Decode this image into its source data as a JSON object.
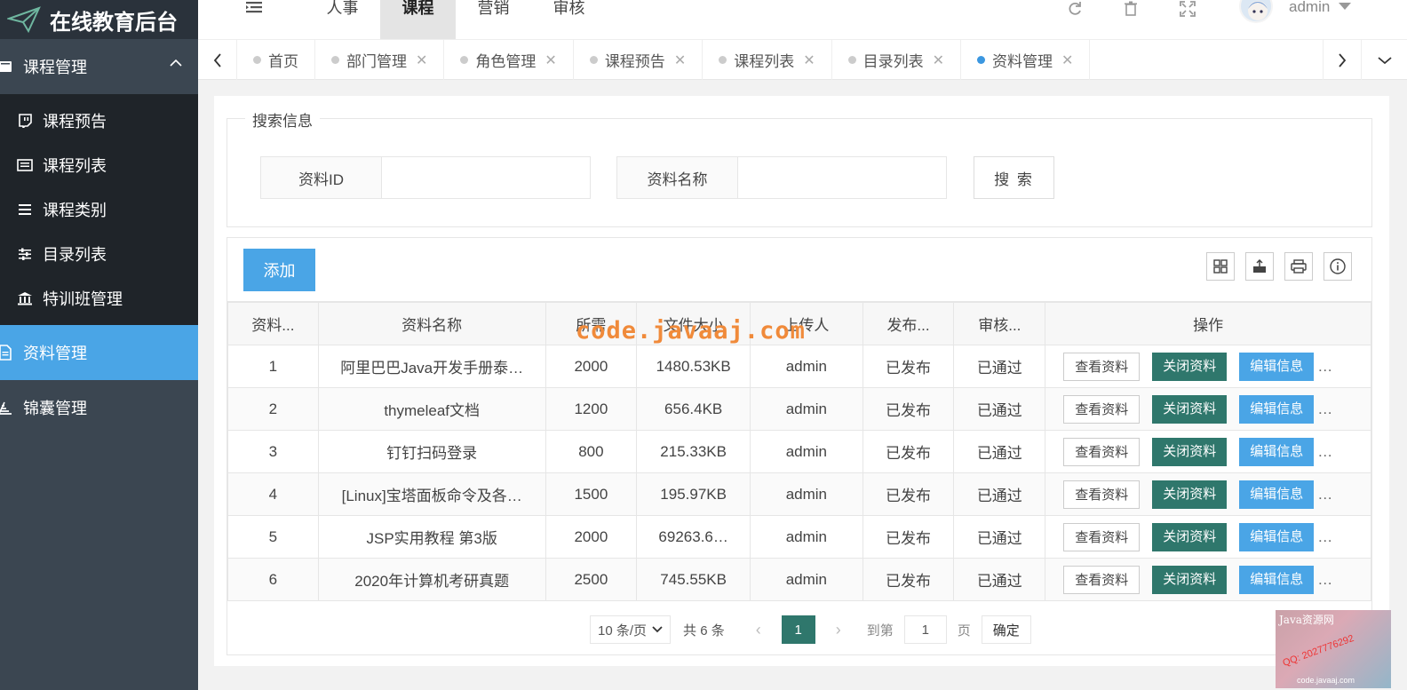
{
  "app": {
    "title": "在线教育后台"
  },
  "header": {
    "nav": [
      "人事",
      "课程",
      "营销",
      "审核"
    ],
    "active_nav": 1,
    "user": "admin"
  },
  "sidebar": {
    "group": {
      "label": "课程管理"
    },
    "sub_items": [
      {
        "label": "课程预告",
        "icon": "twitch-icon"
      },
      {
        "label": "课程列表",
        "icon": "list-icon"
      },
      {
        "label": "课程类别",
        "icon": "bars-icon"
      },
      {
        "label": "目录列表",
        "icon": "sliders-icon"
      },
      {
        "label": "特训班管理",
        "icon": "bank-icon"
      }
    ],
    "items": [
      {
        "label": "资料管理",
        "icon": "file-icon",
        "active": true
      },
      {
        "label": "锦囊管理",
        "icon": "steps-icon",
        "active": false
      }
    ]
  },
  "tabs": [
    {
      "label": "首页",
      "closable": false
    },
    {
      "label": "部门管理",
      "closable": true
    },
    {
      "label": "角色管理",
      "closable": true
    },
    {
      "label": "课程预告",
      "closable": true
    },
    {
      "label": "课程列表",
      "closable": true
    },
    {
      "label": "目录列表",
      "closable": true
    },
    {
      "label": "资料管理",
      "closable": true,
      "active": true
    }
  ],
  "search": {
    "legend": "搜索信息",
    "id_label": "资料ID",
    "id_value": "",
    "name_label": "资料名称",
    "name_value": "",
    "button": "搜 索"
  },
  "toolbar": {
    "add_label": "添加"
  },
  "table": {
    "columns": [
      "资料...",
      "资料名称",
      "所需",
      "文件大小",
      "上传人",
      "发布...",
      "审核...",
      "操作"
    ],
    "rows": [
      [
        "1",
        "阿里巴巴Java开发手册泰…",
        "2000",
        "1480.53KB",
        "admin",
        "已发布",
        "已通过"
      ],
      [
        "2",
        "thymeleaf文档",
        "1200",
        "656.4KB",
        "admin",
        "已发布",
        "已通过"
      ],
      [
        "3",
        "钉钉扫码登录",
        "800",
        "215.33KB",
        "admin",
        "已发布",
        "已通过"
      ],
      [
        "4",
        "[Linux]宝塔面板命令及各…",
        "1500",
        "195.97KB",
        "admin",
        "已发布",
        "已通过"
      ],
      [
        "5",
        "JSP实用教程 第3版",
        "2000",
        "69263.6…",
        "admin",
        "已发布",
        "已通过"
      ],
      [
        "6",
        "2020年计算机考研真题",
        "2500",
        "745.55KB",
        "admin",
        "已发布",
        "已通过"
      ]
    ],
    "ops": {
      "view": "查看资料",
      "close": "关闭资料",
      "edit": "编辑信息",
      "more": "…"
    }
  },
  "pager": {
    "per_page": "10 条/页",
    "total": "共 6 条",
    "current": "1",
    "goto_label": "到第",
    "goto_value": "1",
    "page_label": "页",
    "confirm": "确定"
  },
  "watermark": {
    "text": "code.javaaj.com",
    "corner_title": "Java资源网",
    "corner_qq": "QQ: 2027776292",
    "corner_url": "code.javaaj.com"
  }
}
